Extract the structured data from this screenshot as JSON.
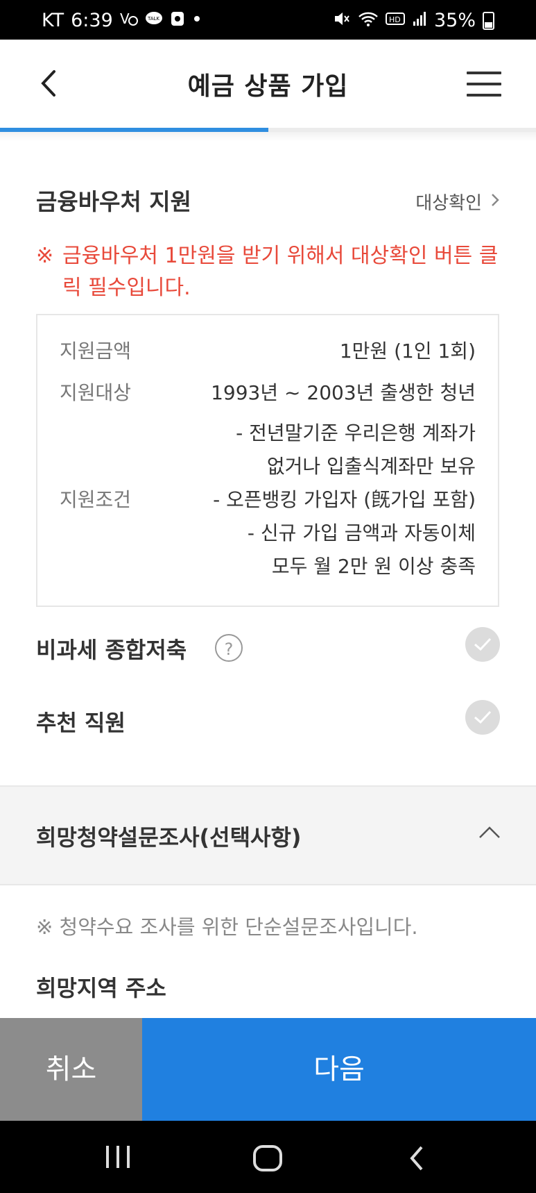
{
  "status_bar": {
    "carrier": "KT",
    "time": "6:39",
    "battery": "35%",
    "icons_left": [
      "network-speed-icon",
      "kakaotalk-icon",
      "notification-icon",
      "dot-icon"
    ],
    "icons_right": [
      "mute-icon",
      "wifi-icon",
      "hd-icon",
      "signal-icon",
      "battery-icon"
    ]
  },
  "header": {
    "title": "예금 상품 가입",
    "progress_fraction": 0.5
  },
  "voucher": {
    "title": "금융바우처 지원",
    "check_link": "대상확인",
    "notice_mark": "※",
    "notice": "금융바우처 1만원을 받기 위해서 대상확인 버튼 클릭 필수입니다.",
    "rows": [
      {
        "key": "지원금액",
        "lines": [
          "1만원 (1인 1회)"
        ]
      },
      {
        "key": "지원대상",
        "lines": [
          "1993년 ~ 2003년 출생한 청년"
        ]
      },
      {
        "key": "지원조건",
        "lines": [
          "- 전년말기준 우리은행 계좌가",
          "없거나 입출식계좌만 보유",
          "- 오픈뱅킹 가입자 (旣가입 포함)",
          "- 신규 가입 금액과 자동이체",
          "모두 월 2만 원 이상 충족"
        ]
      }
    ]
  },
  "options": {
    "tax_free": "비과세 종합저축",
    "help_symbol": "?",
    "recommender": "추천 직원"
  },
  "survey": {
    "title": "희망청약설문조사(선택사항)",
    "note": "※ 청약수요 조사를 위한 단순설문조사입니다.",
    "address_label": "희망지역 주소"
  },
  "buttons": {
    "cancel": "취소",
    "next": "다음"
  },
  "colors": {
    "accent": "#2080e0",
    "warning": "#e8493a",
    "cancel_bg": "#8c8c8c"
  }
}
